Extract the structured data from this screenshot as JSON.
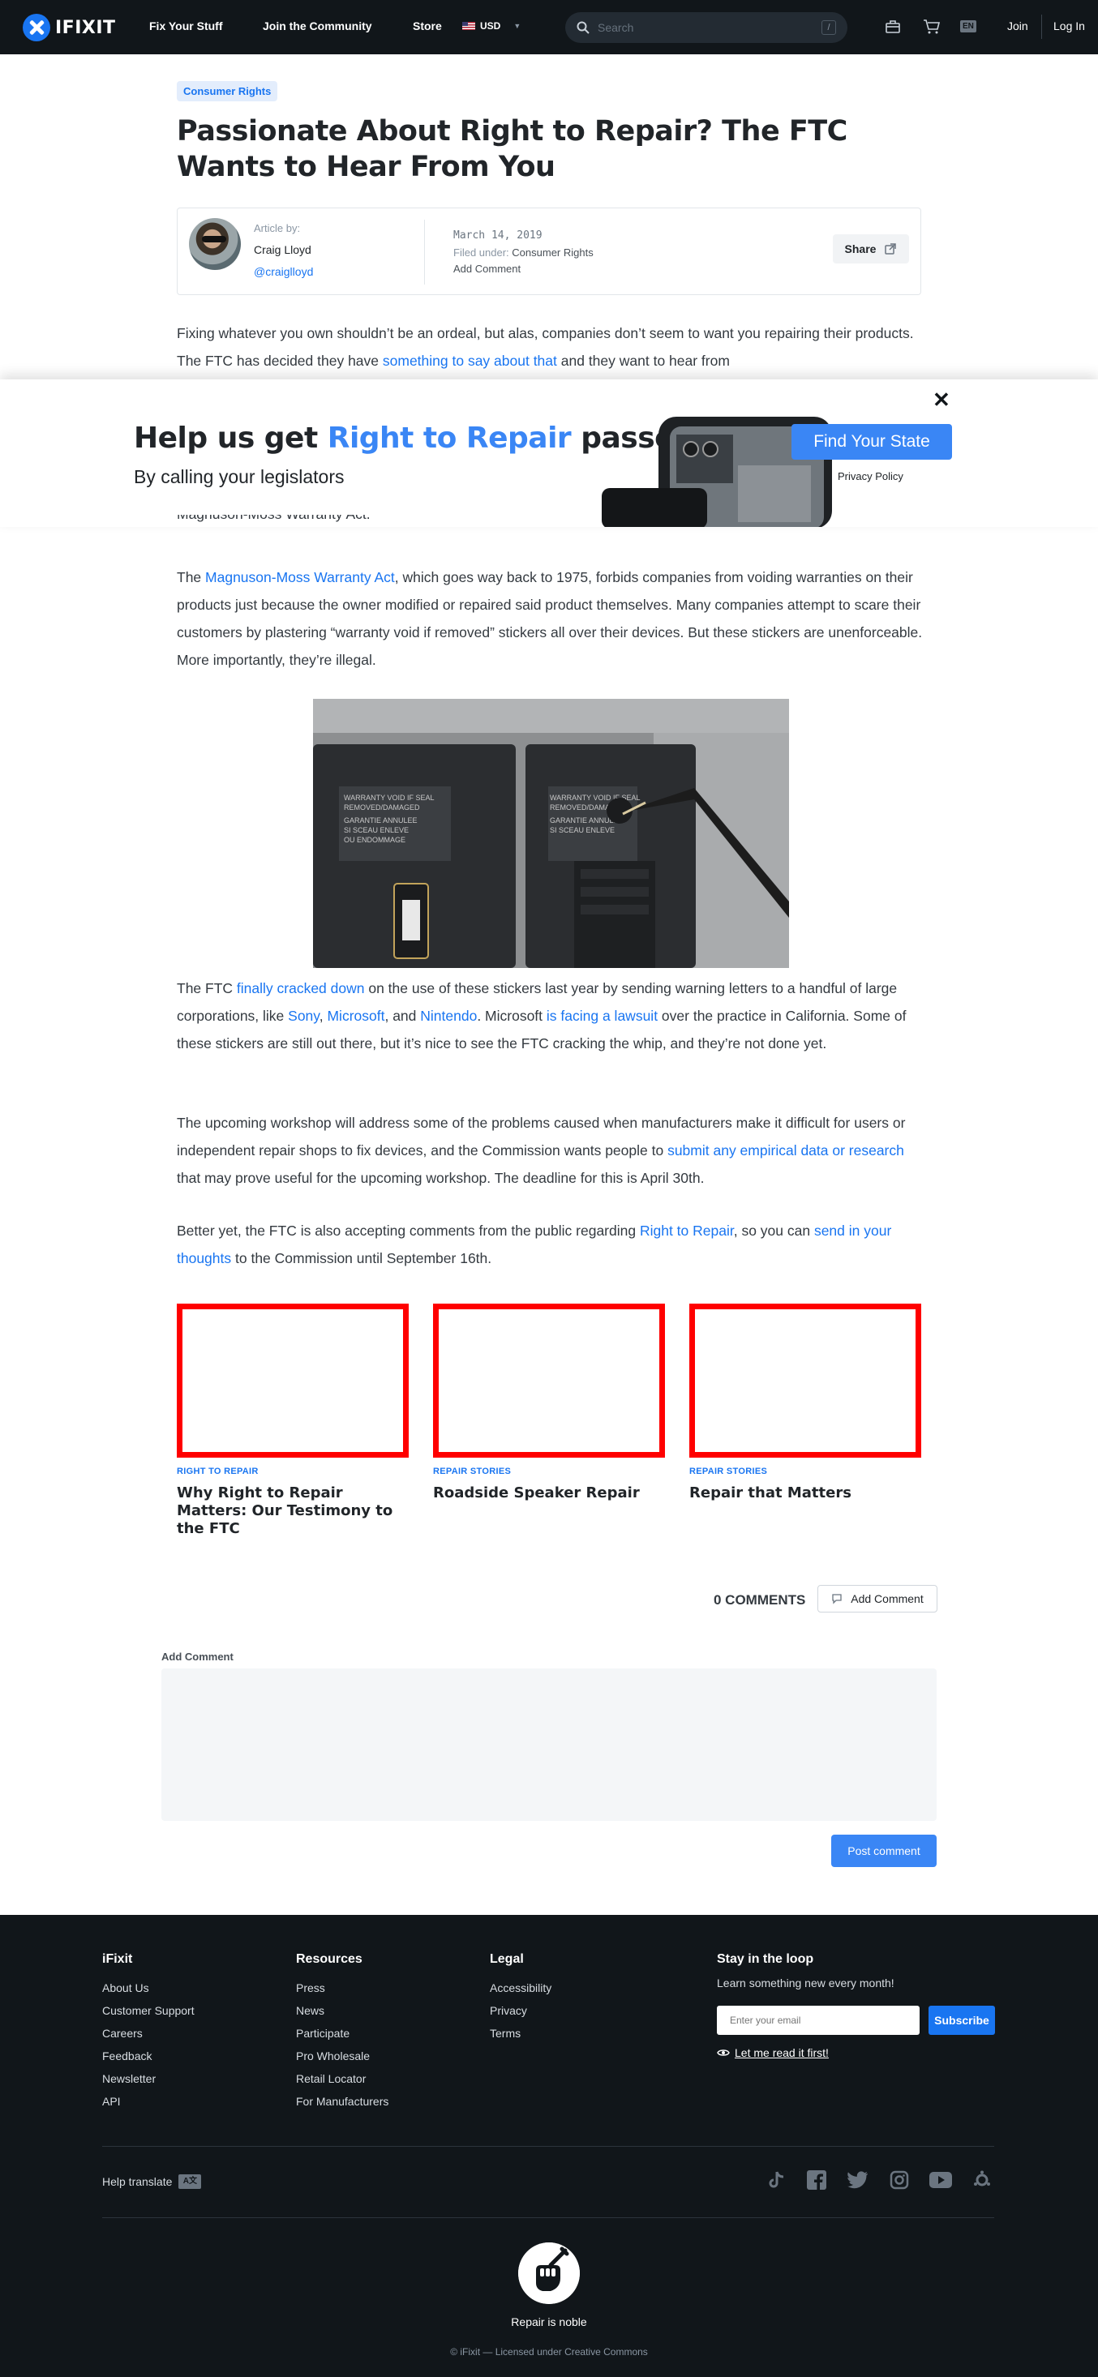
{
  "nav": {
    "brand": "IFIXIT",
    "links": [
      "Fix Your Stuff",
      "Join the Community",
      "Store"
    ],
    "currency": "USD",
    "search_placeholder": "Search",
    "search_shortcut": "/",
    "lang": "EN",
    "join": "Join",
    "login": "Log In"
  },
  "article": {
    "tag": "Consumer Rights",
    "title": "Passionate About Right to Repair? The FTC Wants to Hear From You",
    "byline": {
      "label": "Article by:",
      "author": "Craig Lloyd",
      "handle": "@craiglloyd",
      "date": "March 14, 2019",
      "filed_prefix": "Filed under:",
      "filed": "Consumer Rights",
      "add_comment": "Add Comment",
      "share": "Share"
    },
    "p1": {
      "a": "Fixing whatever you own shouldn’t be an ordeal, but alas, companies don’t seem to want you repairing their products. The FTC has decided they have ",
      "link": "something to say about that",
      "b": " and they want to hear from"
    },
    "p1_cut": "Magnuson-Moss Warranty Act.",
    "p2": {
      "link": "Magnuson-Moss Warranty Act",
      "a": "The ",
      "b": ", which goes way back to 1975, forbids companies from voiding warranties on their products just because the owner modified or repaired said product themselves. Many companies attempt to scare their customers by plastering “warranty void if removed” stickers all over their devices. But these stickers are unenforceable. More importantly, they’re illegal."
    },
    "sticker_text_1": "WARRANTY VOID IF SEAL REMOVED/DAMAGED GARANTIE ANNULEE SI SCEAU ENLEVE OU ENDOMMAGE",
    "p3": {
      "a": "The FTC ",
      "l1": "finally cracked down",
      "b": " on the use of these stickers last year by sending warning letters to a handful of large corporations, like ",
      "l2": "Sony",
      "c": ", ",
      "l3": "Microsoft",
      "d": ", and ",
      "l4": "Nintendo",
      "e": ". Microsoft ",
      "l5": "is facing a lawsuit",
      "f": " over the practice in California. Some of these stickers are still out there, but it’s nice to see the FTC cracking the whip, and they’re not done yet."
    },
    "p4": {
      "a": "The upcoming workshop will address some of the problems caused when manufacturers make it difficult for users or independent repair shops to fix devices, and the Commission wants people to ",
      "link": "submit any empirical data or research",
      "b": " that may prove useful for the upcoming workshop. The deadline for this is April 30th."
    },
    "p5": {
      "a": "Better yet, the FTC is also accepting comments from the public regarding ",
      "l1": "Right to Repair",
      "b": ", so you can ",
      "l2": "send in your thoughts",
      "c": " to the Commission until September 16th."
    }
  },
  "banner": {
    "close": "✕",
    "heading_a": "Help us get ",
    "heading_hl": "Right to Repair",
    "heading_b": " passed",
    "sub": "By calling your legislators",
    "cta": "Find Your State",
    "privacy": "Privacy Policy"
  },
  "related": [
    {
      "category": "RIGHT TO REPAIR",
      "title": "Why Right to Repair Matters: Our Testimony to the FTC"
    },
    {
      "category": "REPAIR STORIES",
      "title": "Roadside Speaker Repair"
    },
    {
      "category": "REPAIR STORIES",
      "title": "Repair that Matters"
    }
  ],
  "comments": {
    "count": "0 COMMENTS",
    "add_button": "Add Comment",
    "form_label": "Add Comment",
    "post": "Post comment"
  },
  "footer": {
    "col1": {
      "title": "iFixit",
      "links": [
        "About Us",
        "Customer Support",
        "Careers",
        "Feedback",
        "Newsletter",
        "API"
      ]
    },
    "col2": {
      "title": "Resources",
      "links": [
        "Press",
        "News",
        "Participate",
        "Pro Wholesale",
        "Retail Locator",
        "For Manufacturers"
      ]
    },
    "col3": {
      "title": "Legal",
      "links": [
        "Accessibility",
        "Privacy",
        "Terms"
      ]
    },
    "stay": {
      "title": "Stay in the loop",
      "sub": "Learn something new every month!",
      "email_placeholder": "Enter your email",
      "subscribe": "Subscribe",
      "read_first": "Let me read it first!"
    },
    "help_translate": "Help translate",
    "socials": [
      "tiktok-icon",
      "facebook-icon",
      "twitter-icon",
      "instagram-icon",
      "youtube-icon",
      "hubspot-icon"
    ],
    "tagline": "Repair is noble",
    "copyright": "© iFixit — Licensed under Creative Commons"
  },
  "colors": {
    "accent": "#1975f1",
    "banner_accent": "#3a86f5",
    "nav_bg": "#11161a",
    "card_border": "#ff0000"
  }
}
